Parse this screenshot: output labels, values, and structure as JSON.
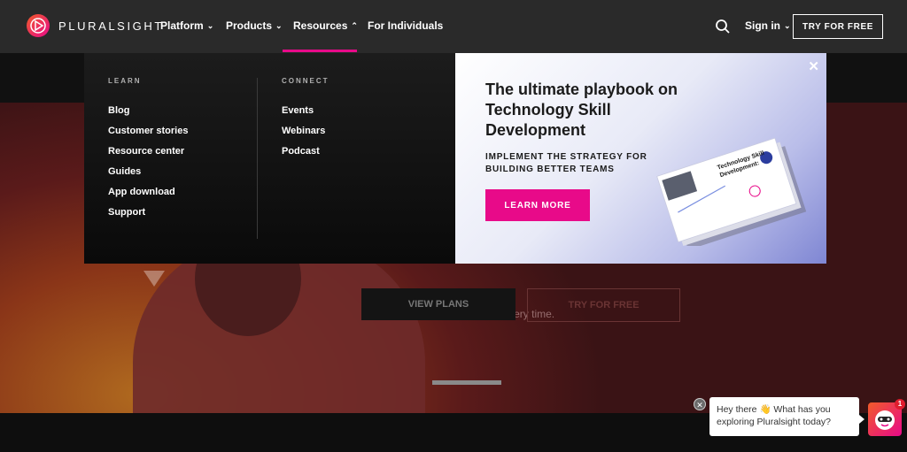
{
  "brand": {
    "name": "PLURALSIGHT"
  },
  "nav": {
    "items": [
      {
        "label": "Platform",
        "has_menu": true
      },
      {
        "label": "Products",
        "has_menu": true
      },
      {
        "label": "Resources",
        "has_menu": true,
        "active": true
      },
      {
        "label": "For Individuals",
        "has_menu": false
      }
    ],
    "sign_in": "Sign in",
    "try_free": "TRY FOR FREE",
    "accent": "#e80a89"
  },
  "mega_menu": {
    "learn": {
      "heading": "LEARN",
      "items": [
        "Blog",
        "Customer stories",
        "Resource center",
        "Guides",
        "App download",
        "Support"
      ]
    },
    "connect": {
      "heading": "CONNECT",
      "items": [
        "Events",
        "Webinars",
        "Podcast"
      ]
    },
    "promo": {
      "title": "The ultimate playbook on Technology Skill Development",
      "subtitle": "IMPLEMENT THE STRATEGY FOR BUILDING BETTER TEAMS",
      "cta": "LEARN MORE",
      "book_title_line1": "Technology Skill",
      "book_title_line2": "Development:",
      "close": "✕"
    }
  },
  "hero": {
    "subtitle": "actionable data. Build better - every time.",
    "view_plans": "VIEW PLANS",
    "try_free": "TRY FOR FREE"
  },
  "chat": {
    "message_line1": "Hey there 👋 What has you",
    "message_line2": "exploring Pluralsight today?",
    "badge_count": "1",
    "close": "✕"
  }
}
